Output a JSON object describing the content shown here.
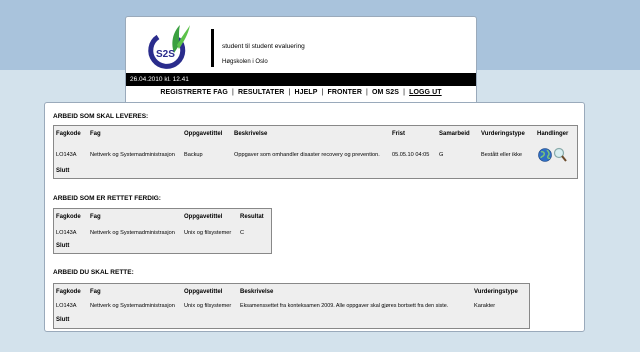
{
  "header": {
    "logo_text": "S2S",
    "tagline": "student til student evaluering",
    "school": "Høgskolen i Oslo",
    "datetime": "26.04.2010 kl. 12.41"
  },
  "nav": {
    "items": [
      "REGISTRERTE FAG",
      "RESULTATER",
      "HJELP",
      "FRONTER",
      "OM S2S",
      "LOGG UT"
    ],
    "separator": "|"
  },
  "sections": {
    "to_deliver": {
      "title": "ARBEID SOM SKAL LEVERES:",
      "headers": [
        "Fagkode",
        "Fag",
        "Oppgavetittel",
        "Beskrivelse",
        "Frist",
        "Samarbeid",
        "Vurderingstype",
        "Handlinger"
      ],
      "row": [
        "LO143A",
        "Nettverk og Systemadministrasjon",
        "Backup",
        "Oppgaver som omhandler disaster recovery og prevention.",
        "05.05.10 04:05",
        "G",
        "Bestått eller ikke"
      ],
      "end": "Slutt"
    },
    "graded": {
      "title": "ARBEID SOM ER RETTET FERDIG:",
      "headers": [
        "Fagkode",
        "Fag",
        "Oppgavetittel",
        "Resultat"
      ],
      "row": [
        "LO143A",
        "Nettverk og Systemadministrasjon",
        "Unix og filsystemer",
        "C"
      ],
      "end": "Slutt"
    },
    "to_grade": {
      "title": "ARBEID DU SKAL RETTE:",
      "headers": [
        "Fagkode",
        "Fag",
        "Oppgavetittel",
        "Beskrivelse",
        "Vurderingstype"
      ],
      "row": [
        "LO143A",
        "Nettverk og Systemadministrasjon",
        "Unix og filsystemer",
        "Eksamenssettet fra konteksamen 2009. Alle oppgaver skal gjøres bortsett fra den siste.",
        "Karakter"
      ],
      "end": "Slutt"
    }
  },
  "icons": {
    "globe": "globe-icon",
    "magnifier": "magnifier-icon"
  },
  "colors": {
    "logo_blue": "#2a2c8c",
    "logo_green": "#3aa040",
    "panel_bg": "#eeeeee"
  }
}
